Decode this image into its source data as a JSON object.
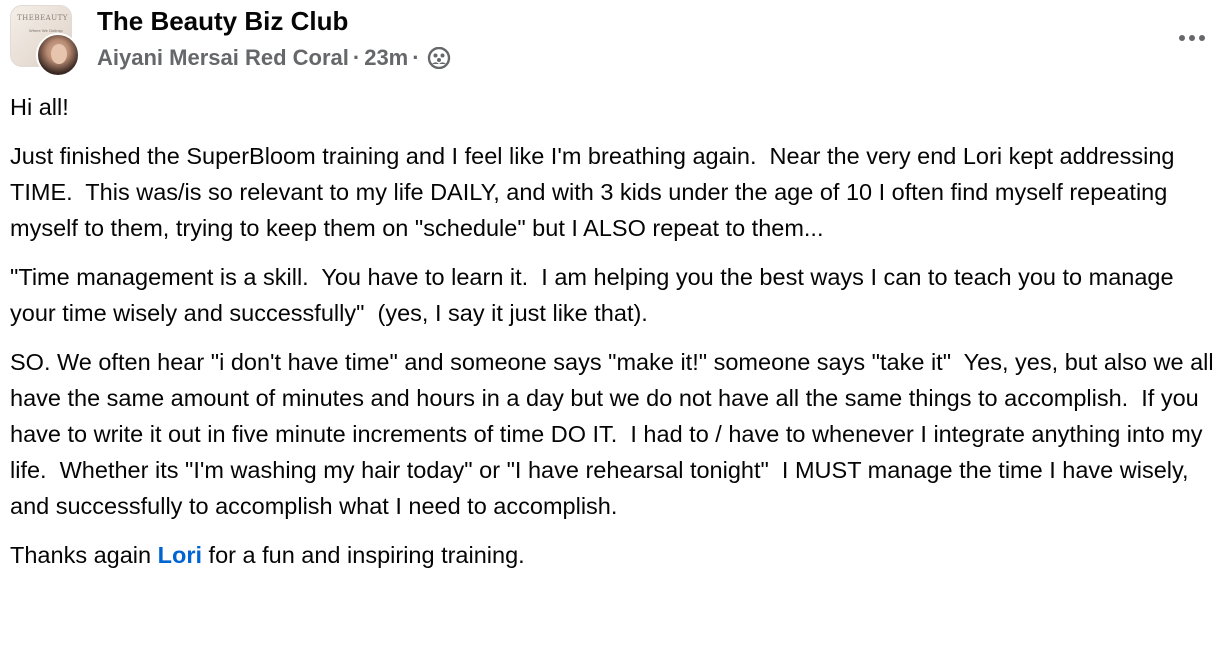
{
  "post": {
    "group_name": "The Beauty Biz Club",
    "group_thumb_text": "THEBEAUTY BIZ CL",
    "group_thumb_sub": "Where We Outinsp",
    "author": "Aiyani Mersai Red Coral",
    "separator": "·",
    "time": "23m",
    "privacy_icon": "group-members-icon",
    "more_icon": "more-options-icon",
    "paragraphs": [
      "Hi all!",
      "Just finished the SuperBloom training and I feel like I'm breathing again.  Near the very end Lori kept addressing TIME.  This was/is so relevant to my life DAILY, and with 3 kids under the age of 10 I often find myself repeating myself to them, trying to keep them on \"schedule\" but I ALSO repeat to them...",
      "\"Time management is a skill.  You have to learn it.  I am helping you the best ways I can to teach you to manage your time wisely and successfully\"  (yes, I say it just like that).",
      "SO. We often hear \"i don't have time\" and someone says \"make it!\" someone says \"take it\"  Yes, yes, but also we all have the same amount of minutes and hours in a day but we do not have all the same things to accomplish.  If you have to write it out in five minute increments of time DO IT.  I had to / have to whenever I integrate anything into my life.  Whether its \"I'm washing my hair today\" or \"I have rehearsal tonight\"  I MUST manage the time I have wisely, and successfully to accomplish what I need to accomplish."
    ],
    "closing": {
      "before": "Thanks again ",
      "mention": "Lori",
      "after": " for a fun and inspiring training."
    },
    "colors": {
      "text": "#050505",
      "secondary": "#65676b",
      "mention": "#0064d1"
    }
  }
}
